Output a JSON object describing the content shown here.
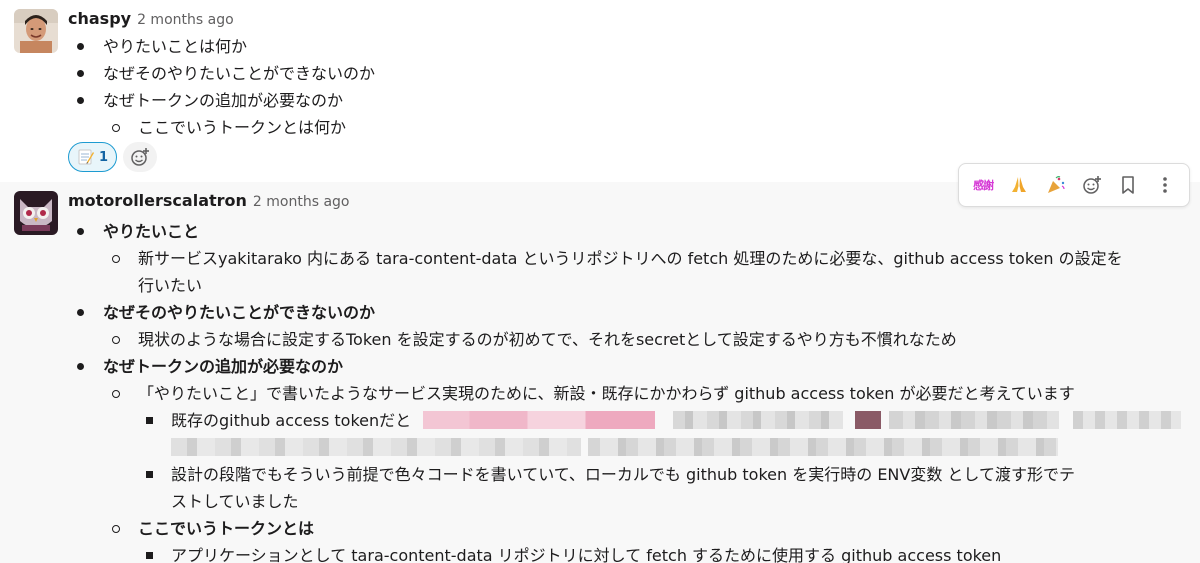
{
  "messages": [
    {
      "author": "chaspy",
      "timestamp": "2 months ago",
      "items": [
        {
          "level": 1,
          "text": "やりたいことは何か"
        },
        {
          "level": 1,
          "text": "なぜそのやりたいことができないのか"
        },
        {
          "level": 1,
          "text": "なぜトークンの追加が必要なのか"
        },
        {
          "level": 2,
          "text": "ここでいうトークンとは何か"
        }
      ],
      "reactions": [
        {
          "emoji": "memo-emoji",
          "count": "1"
        }
      ]
    },
    {
      "author": "motorollerscalatron",
      "timestamp": "2 months ago",
      "items": [
        {
          "level": 1,
          "bold": true,
          "text": "やりたいこと"
        },
        {
          "level": 2,
          "text": "新サービスyakitarako 内にある tara-content-data というリポジトリへの fetch 処理のために必要な、github access token の設定を"
        },
        {
          "level": 2,
          "text": "行いたい",
          "continuation": true
        },
        {
          "level": 1,
          "bold": true,
          "text": "なぜそのやりたいことができないのか"
        },
        {
          "level": 2,
          "text": "現状のような場合に設定するToken を設定するのが初めてで、それをsecretとして設定するやり方も不慣れなため"
        },
        {
          "level": 1,
          "bold": true,
          "text": "なぜトークンの追加が必要なのか"
        },
        {
          "level": 2,
          "text": "「やりたいこと」で書いたようなサービス実現のために、新設・既存にかかわらず github access token が必要だと考えています"
        },
        {
          "level": 3,
          "text": "既存のgithub access tokenだと"
        },
        {
          "level": 3,
          "text": "設計の段階でもそういう前提で色々コードを書いていて、ローカルでも github token を実行時の ENV変数 として渡す形でテ"
        },
        {
          "level": 3,
          "text": "ストしていました",
          "continuation": true
        },
        {
          "level": 2,
          "bold": true,
          "text": "ここでいうトークンとは"
        },
        {
          "level": 3,
          "text": "アプリケーションとして tara-content-data リポジトリに対して fetch するために使用する github access token"
        }
      ]
    }
  ],
  "toolbar": {
    "emoji_1": "感謝",
    "icons": [
      "pray-emoji",
      "party-popper-emoji",
      "add-reaction-icon",
      "bookmark-icon",
      "more-vertical-icon"
    ]
  },
  "colors": {
    "accent": "#1264a3",
    "reaction_border": "#1d9bd1",
    "reaction_bg": "#e8f5fa",
    "hover_bg": "#f8f8f8",
    "text": "#1d1c1d",
    "muted": "#616061",
    "thanks_magenta": "#d63ad6"
  }
}
